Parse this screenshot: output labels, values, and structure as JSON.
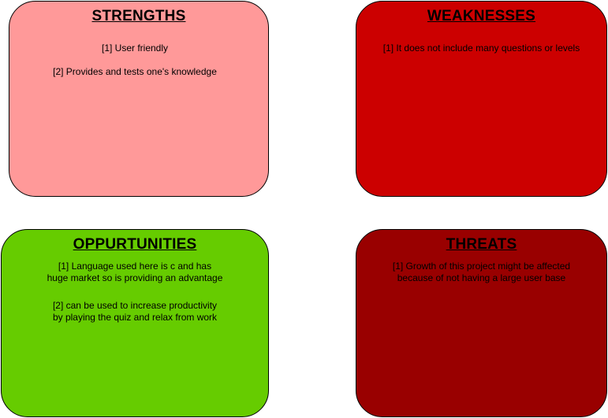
{
  "strengths": {
    "title": "STRENGTHS",
    "color": "#FF9999",
    "points": [
      "[1] User friendly",
      "[2] Provides and tests one's knowledge"
    ]
  },
  "weaknesses": {
    "title": "WEAKNESSES",
    "color": "#CC0000",
    "points": [
      "[1] It does not include many questions or levels"
    ]
  },
  "opportunities": {
    "title": "OPPURTUNITIES",
    "color": "#66CC00",
    "points": [
      [
        "[1] Language used here is c and has",
        "huge market so is providing an advantage"
      ],
      [
        "[2] can be used to increase productivity",
        "by playing the quiz and relax from work"
      ]
    ]
  },
  "threats": {
    "title": "THREATS",
    "color": "#990000",
    "points": [
      [
        "[1] Growth of this project might be affected",
        "because of not having a large user base"
      ]
    ]
  }
}
